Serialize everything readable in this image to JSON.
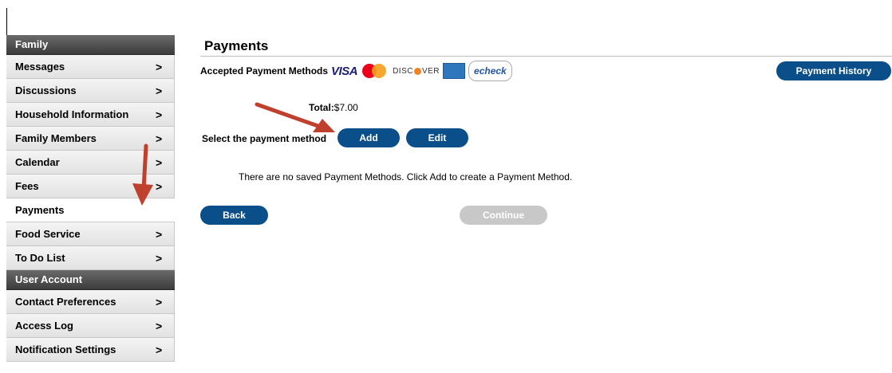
{
  "sidebar": {
    "family_header": "Family",
    "family_items": [
      {
        "label": "Messages",
        "chevron": ">"
      },
      {
        "label": "Discussions",
        "chevron": ">"
      },
      {
        "label": "Household Information",
        "chevron": ">"
      },
      {
        "label": "Family Members",
        "chevron": ">"
      },
      {
        "label": "Calendar",
        "chevron": ">"
      },
      {
        "label": "Fees",
        "chevron": ">"
      },
      {
        "label": "Payments",
        "chevron": ""
      },
      {
        "label": "Food Service",
        "chevron": ">"
      },
      {
        "label": "To Do List",
        "chevron": ">"
      }
    ],
    "user_header": "User Account",
    "user_items": [
      {
        "label": "Contact Preferences",
        "chevron": ">"
      },
      {
        "label": "Access Log",
        "chevron": ">"
      },
      {
        "label": "Notification Settings",
        "chevron": ">"
      }
    ]
  },
  "main": {
    "title": "Payments",
    "accepted_label": "Accepted Payment Methods",
    "logos": {
      "visa": "VISA",
      "discover": "DISC",
      "discover_tail": "VER",
      "echeck": "echeck"
    },
    "payment_history_button": "Payment History",
    "total_label": "Total:",
    "total_value": "$7.00",
    "select_label": "Select the payment method",
    "add_button": "Add",
    "edit_button": "Edit",
    "no_methods_message": "There are no saved Payment Methods. Click Add to create a Payment Method.",
    "back_button": "Back",
    "continue_button": "Continue"
  },
  "colors": {
    "primary_button": "#0b4f8a",
    "disabled_button": "#c8c8c8",
    "annotation_arrow": "#c0402e"
  }
}
